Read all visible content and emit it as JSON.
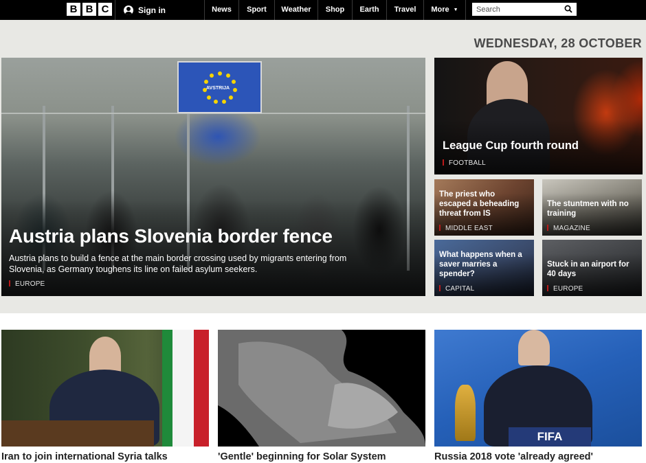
{
  "header": {
    "logo_letters": [
      "B",
      "B",
      "C"
    ],
    "signin_label": "Sign in",
    "nav": [
      {
        "label": "News"
      },
      {
        "label": "Sport"
      },
      {
        "label": "Weather"
      },
      {
        "label": "Shop"
      },
      {
        "label": "Earth"
      },
      {
        "label": "Travel"
      },
      {
        "label": "More"
      }
    ],
    "search_placeholder": "Search"
  },
  "date": "WEDNESDAY, 28 OCTOBER",
  "hero": {
    "sign_text": "AVSTRIJA",
    "headline": "Austria plans Slovenia border fence",
    "summary_line1": "Austria plans to build a fence at the main border crossing used by migrants entering from",
    "summary_line2": "Slovenia, as Germany toughens its line on failed asylum seekers.",
    "tag": "EUROPE"
  },
  "side": {
    "main": {
      "headline": "League Cup fourth round",
      "tag": "FOOTBALL"
    },
    "items": [
      {
        "headline_l1": "The priest who",
        "headline_l2": "escaped a beheading",
        "headline_l3": "threat from IS",
        "tag": "MIDDLE EAST"
      },
      {
        "headline_l1": "The stuntmen with no",
        "headline_l2": "training",
        "tag": "MAGAZINE"
      },
      {
        "headline_l1": "What happens when a",
        "headline_l2": "saver marries a",
        "headline_l3": "spender?",
        "tag": "CAPITAL"
      },
      {
        "headline_l1": "Stuck in an airport for",
        "headline_l2": "40 days",
        "tag": "EUROPE"
      }
    ]
  },
  "bottom": [
    {
      "headline": "Iran to join international Syria talks"
    },
    {
      "headline": "'Gentle' beginning for Solar System"
    },
    {
      "headline": "Russia 2018 vote 'already agreed'",
      "sign_text": "FIFA"
    }
  ],
  "colors": {
    "topbar": "#000000",
    "page_bg": "#e8e8e4",
    "tag_accent": "#bb1919"
  }
}
